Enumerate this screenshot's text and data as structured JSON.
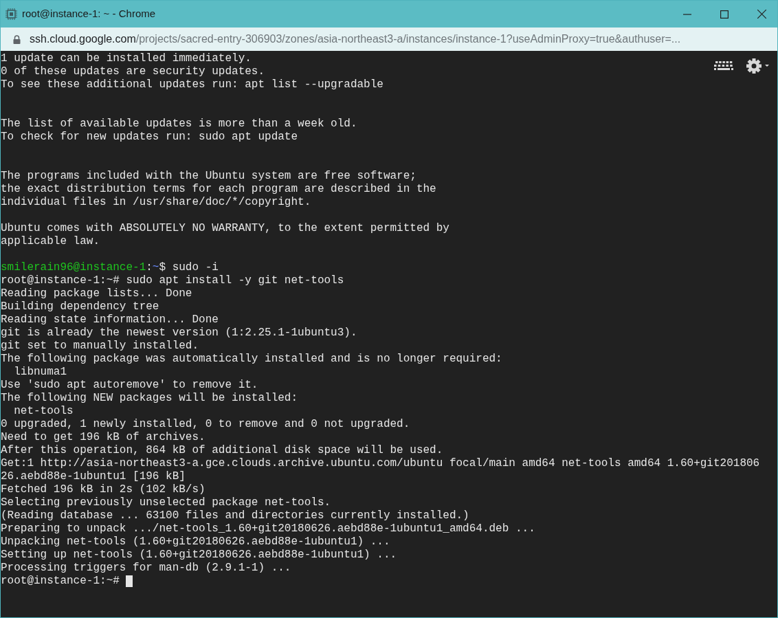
{
  "window": {
    "title": "root@instance-1: ~ - Chrome"
  },
  "address_bar": {
    "host": "ssh.cloud.google.com",
    "path": "/projects/sacred-entry-306903/zones/asia-northeast3-a/instances/instance-1?useAdminProxy=true&authuser=..."
  },
  "terminal": {
    "lines": [
      {
        "kind": "text",
        "segments": [
          {
            "kind": "plain",
            "text": "1 update can be installed immediately."
          }
        ]
      },
      {
        "kind": "text",
        "segments": [
          {
            "kind": "plain",
            "text": "0 of these updates are security updates."
          }
        ]
      },
      {
        "kind": "text",
        "segments": [
          {
            "kind": "plain",
            "text": "To see these additional updates run: apt list --upgradable"
          }
        ]
      },
      {
        "kind": "blank"
      },
      {
        "kind": "blank"
      },
      {
        "kind": "text",
        "segments": [
          {
            "kind": "plain",
            "text": "The list of available updates is more than a week old."
          }
        ]
      },
      {
        "kind": "text",
        "segments": [
          {
            "kind": "plain",
            "text": "To check for new updates run: sudo apt update"
          }
        ]
      },
      {
        "kind": "blank"
      },
      {
        "kind": "blank"
      },
      {
        "kind": "text",
        "segments": [
          {
            "kind": "plain",
            "text": "The programs included with the Ubuntu system are free software;"
          }
        ]
      },
      {
        "kind": "text",
        "segments": [
          {
            "kind": "plain",
            "text": "the exact distribution terms for each program are described in the"
          }
        ]
      },
      {
        "kind": "text",
        "segments": [
          {
            "kind": "plain",
            "text": "individual files in /usr/share/doc/*/copyright."
          }
        ]
      },
      {
        "kind": "blank"
      },
      {
        "kind": "text",
        "segments": [
          {
            "kind": "plain",
            "text": "Ubuntu comes with ABSOLUTELY NO WARRANTY, to the extent permitted by"
          }
        ]
      },
      {
        "kind": "text",
        "segments": [
          {
            "kind": "plain",
            "text": "applicable law."
          }
        ]
      },
      {
        "kind": "blank"
      },
      {
        "kind": "text",
        "segments": [
          {
            "kind": "user",
            "text": "smilerain96@instance-1"
          },
          {
            "kind": "plain",
            "text": ":"
          },
          {
            "kind": "path",
            "text": "~"
          },
          {
            "kind": "plain",
            "text": "$ sudo -i"
          }
        ]
      },
      {
        "kind": "text",
        "segments": [
          {
            "kind": "plain",
            "text": "root@instance-1:~# sudo apt install -y git net-tools"
          }
        ]
      },
      {
        "kind": "text",
        "segments": [
          {
            "kind": "plain",
            "text": "Reading package lists... Done"
          }
        ]
      },
      {
        "kind": "text",
        "segments": [
          {
            "kind": "plain",
            "text": "Building dependency tree"
          }
        ]
      },
      {
        "kind": "text",
        "segments": [
          {
            "kind": "plain",
            "text": "Reading state information... Done"
          }
        ]
      },
      {
        "kind": "text",
        "segments": [
          {
            "kind": "plain",
            "text": "git is already the newest version (1:2.25.1-1ubuntu3)."
          }
        ]
      },
      {
        "kind": "text",
        "segments": [
          {
            "kind": "plain",
            "text": "git set to manually installed."
          }
        ]
      },
      {
        "kind": "text",
        "segments": [
          {
            "kind": "plain",
            "text": "The following package was automatically installed and is no longer required:"
          }
        ]
      },
      {
        "kind": "text",
        "segments": [
          {
            "kind": "plain",
            "text": "  libnuma1"
          }
        ]
      },
      {
        "kind": "text",
        "segments": [
          {
            "kind": "plain",
            "text": "Use 'sudo apt autoremove' to remove it."
          }
        ]
      },
      {
        "kind": "text",
        "segments": [
          {
            "kind": "plain",
            "text": "The following NEW packages will be installed:"
          }
        ]
      },
      {
        "kind": "text",
        "segments": [
          {
            "kind": "plain",
            "text": "  net-tools"
          }
        ]
      },
      {
        "kind": "text",
        "segments": [
          {
            "kind": "plain",
            "text": "0 upgraded, 1 newly installed, 0 to remove and 0 not upgraded."
          }
        ]
      },
      {
        "kind": "text",
        "segments": [
          {
            "kind": "plain",
            "text": "Need to get 196 kB of archives."
          }
        ]
      },
      {
        "kind": "text",
        "segments": [
          {
            "kind": "plain",
            "text": "After this operation, 864 kB of additional disk space will be used."
          }
        ]
      },
      {
        "kind": "text",
        "segments": [
          {
            "kind": "plain",
            "text": "Get:1 http://asia-northeast3-a.gce.clouds.archive.ubuntu.com/ubuntu focal/main amd64 net-tools amd64 1.60+git201806"
          }
        ]
      },
      {
        "kind": "text",
        "segments": [
          {
            "kind": "plain",
            "text": "26.aebd88e-1ubuntu1 [196 kB]"
          }
        ]
      },
      {
        "kind": "text",
        "segments": [
          {
            "kind": "plain",
            "text": "Fetched 196 kB in 2s (102 kB/s)"
          }
        ]
      },
      {
        "kind": "text",
        "segments": [
          {
            "kind": "plain",
            "text": "Selecting previously unselected package net-tools."
          }
        ]
      },
      {
        "kind": "text",
        "segments": [
          {
            "kind": "plain",
            "text": "(Reading database ... 63100 files and directories currently installed.)"
          }
        ]
      },
      {
        "kind": "text",
        "segments": [
          {
            "kind": "plain",
            "text": "Preparing to unpack .../net-tools_1.60+git20180626.aebd88e-1ubuntu1_amd64.deb ..."
          }
        ]
      },
      {
        "kind": "text",
        "segments": [
          {
            "kind": "plain",
            "text": "Unpacking net-tools (1.60+git20180626.aebd88e-1ubuntu1) ..."
          }
        ]
      },
      {
        "kind": "text",
        "segments": [
          {
            "kind": "plain",
            "text": "Setting up net-tools (1.60+git20180626.aebd88e-1ubuntu1) ..."
          }
        ]
      },
      {
        "kind": "text",
        "segments": [
          {
            "kind": "plain",
            "text": "Processing triggers for man-db (2.9.1-1) ..."
          }
        ]
      },
      {
        "kind": "prompt",
        "segments": [
          {
            "kind": "plain",
            "text": "root@instance-1:~# "
          }
        ]
      }
    ]
  }
}
